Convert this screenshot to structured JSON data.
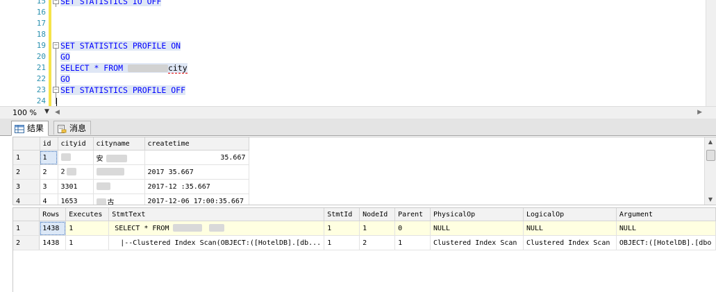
{
  "editor": {
    "line_numbers": [
      "15",
      "16",
      "17",
      "18",
      "19",
      "20",
      "21",
      "22",
      "23",
      "24"
    ],
    "lines": {
      "l15": "SET STATISTICS IO OFF",
      "l19": "SET STATISTICS PROFILE ON",
      "l20": "GO",
      "l21_prefix": "SELECT * FROM ",
      "l21_suffix": "city",
      "l22": "GO",
      "l23": "SET STATISTICS PROFILE OFF"
    }
  },
  "zoom": {
    "value": "100 %"
  },
  "tabs": [
    {
      "label": "结果",
      "icon": "grid-icon"
    },
    {
      "label": "消息",
      "icon": "message-icon"
    }
  ],
  "results1": {
    "columns": [
      "id",
      "cityid",
      "cityname",
      "createtime"
    ],
    "rows": [
      {
        "rn": "1",
        "id": "1",
        "cityid": "",
        "cityname": "安",
        "createtime": "35.667"
      },
      {
        "rn": "2",
        "id": "2",
        "cityid": "2",
        "cityname": "",
        "createtime": "2017  35.667"
      },
      {
        "rn": "3",
        "id": "3",
        "cityid": "3301",
        "cityname": "",
        "createtime": "2017-12 :35.667"
      },
      {
        "rn": "4",
        "id": "4",
        "cityid": "1653",
        "cityname": "古",
        "createtime": "2017-12-06 17:00:35.667"
      }
    ]
  },
  "results2": {
    "columns": [
      "Rows",
      "Executes",
      "StmtText",
      "StmtId",
      "NodeId",
      "Parent",
      "PhysicalOp",
      "LogicalOp",
      "Argument"
    ],
    "rows": [
      {
        "rn": "1",
        "Rows": "1438",
        "Executes": "1",
        "StmtText": "SELECT * FROM",
        "StmtId": "1",
        "NodeId": "1",
        "Parent": "0",
        "PhysicalOp": "NULL",
        "LogicalOp": "NULL",
        "Argument": "NULL"
      },
      {
        "rn": "2",
        "Rows": "1438",
        "Executes": "1",
        "StmtText": "|--Clustered Index Scan(OBJECT:([HotelDB].[db...",
        "StmtId": "1",
        "NodeId": "2",
        "Parent": "1",
        "PhysicalOp": "Clustered Index Scan",
        "LogicalOp": "Clustered Index Scan",
        "Argument": "OBJECT:([HotelDB].[dbo"
      }
    ]
  }
}
